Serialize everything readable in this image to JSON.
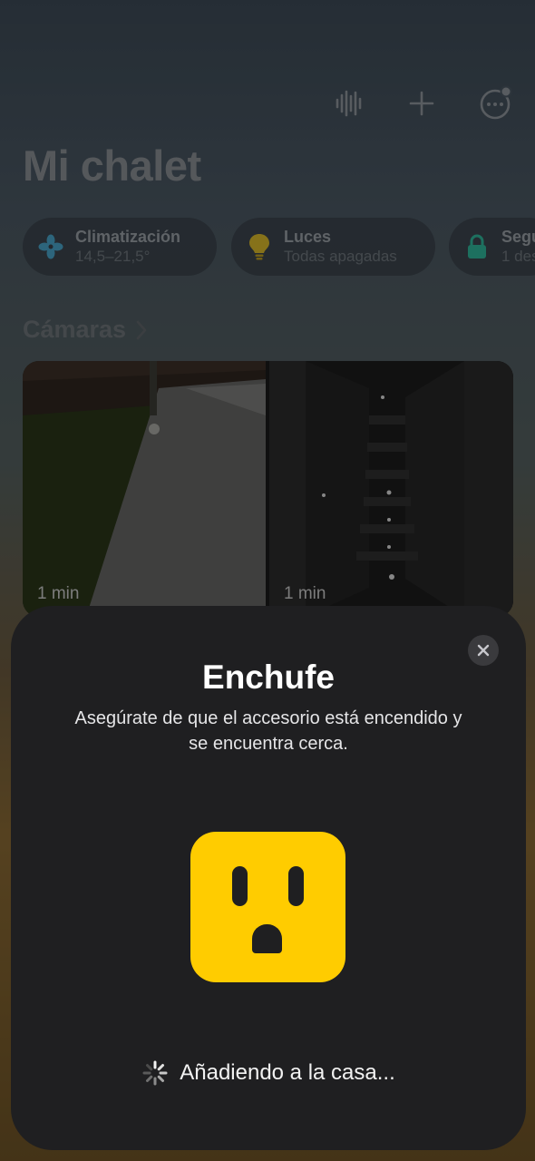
{
  "home": {
    "title": "Mi chalet",
    "header_icons": [
      "waveform-icon",
      "plus-icon",
      "more-icon"
    ]
  },
  "chips": [
    {
      "title": "Climatización",
      "subtitle": "14,5–21,5°",
      "icon": "fan-icon",
      "color": "#4aa3c9"
    },
    {
      "title": "Luces",
      "subtitle": "Todas apagadas",
      "icon": "lightbulb-icon",
      "color": "#d9b92a"
    },
    {
      "title": "Segu",
      "subtitle": "1 des",
      "icon": "lock-icon",
      "color": "#2fb59a"
    }
  ],
  "cameras": {
    "section_title": "Cámaras",
    "items": [
      {
        "time": "1 min"
      },
      {
        "time": "1 min"
      }
    ]
  },
  "sheet": {
    "title": "Enchufe",
    "subtitle": "Asegúrate de que el accesorio está encendido y se encuentra cerca.",
    "status": "Añadiendo a la casa...",
    "accent": "#ffcc00"
  }
}
